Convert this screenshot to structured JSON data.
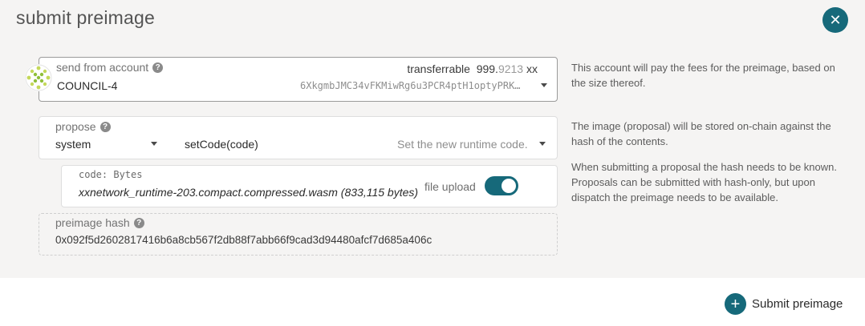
{
  "modal": {
    "title": "submit preimage",
    "close_glyph": "✕"
  },
  "account": {
    "label": "send from account",
    "name": "COUNCIL-4",
    "address": "6XkgmbJMC34vFKMiwRg6u3PCR4ptH1optyPRK…",
    "transferrable_label": "transferrable",
    "balance_int": "999.",
    "balance_dec": "9213",
    "unit": "xx",
    "help": "This account will pay the fees for the preimage, based on the size thereof."
  },
  "propose": {
    "label": "propose",
    "section": "system",
    "method": "setCode(code)",
    "method_desc": "Set the new runtime code.",
    "help_1": "The image (proposal) will be stored on-chain against the hash of the contents.",
    "help_2": "When submitting a proposal the hash needs to be known. Proposals can be submitted with hash-only, but upon dispatch the preimage needs to be available."
  },
  "code": {
    "label": "code: Bytes",
    "file": "xxnetwork_runtime-203.compact.compressed.wasm (833,115 bytes)",
    "file_upload_label": "file upload",
    "file_upload_on": true
  },
  "preimage_hash": {
    "label": "preimage hash",
    "value": "0x092f5d2602817416b6a8cb567f2db88f7abb66f9cad3d94480afcf7d685a406c"
  },
  "footer": {
    "submit_label": "Submit preimage",
    "submit_glyph": "+"
  },
  "help_glyph": "?",
  "colors": {
    "accent": "#16697a",
    "background": "#f5f4f3"
  }
}
